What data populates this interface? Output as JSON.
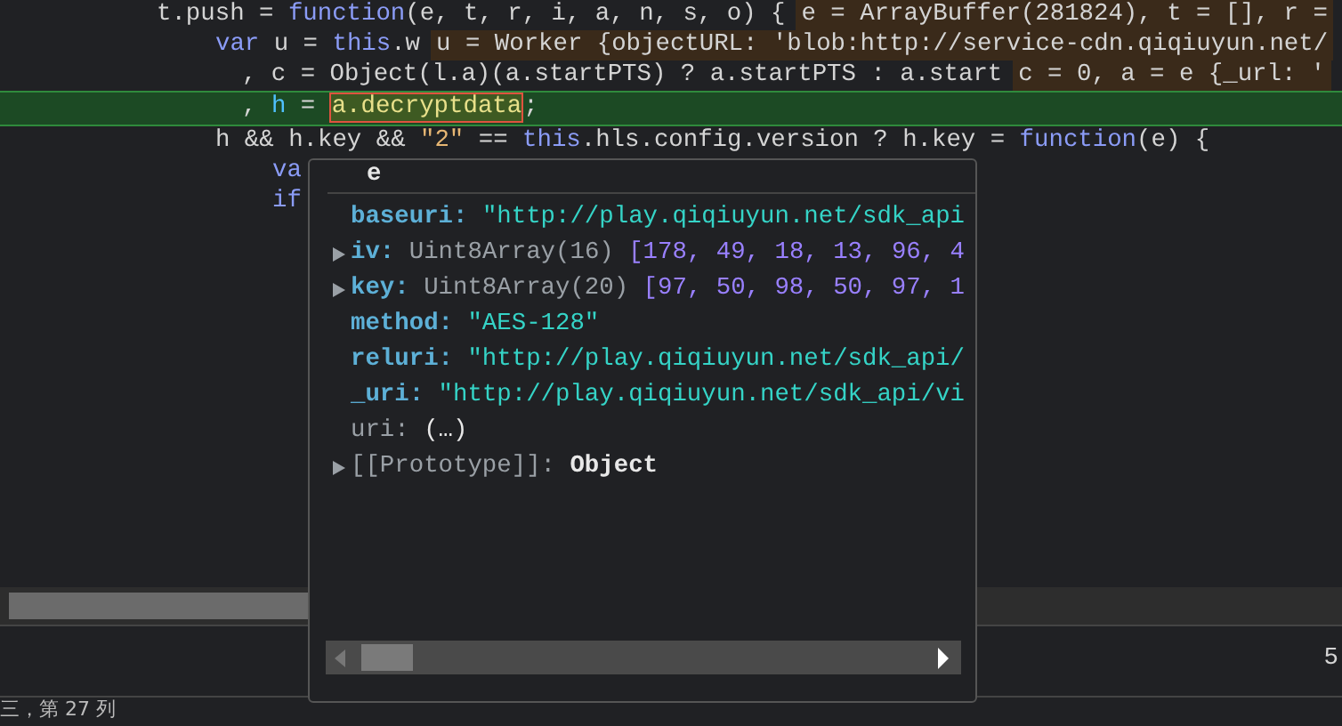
{
  "code_lines": [
    {
      "segments": [
        {
          "text": "t.push = ",
          "kind": "plain"
        },
        {
          "text": "function",
          "kind": "keyword"
        },
        {
          "text": "(e, t, r, i, a, n, s, o) {",
          "kind": "plain"
        }
      ],
      "inline_value": "e = ArrayBuffer(281824), t = [], r =",
      "highlighted": false
    },
    {
      "segments": [
        {
          "text": "var",
          "kind": "keyword"
        },
        {
          "text": " u = ",
          "kind": "plain"
        },
        {
          "text": "this",
          "kind": "keyword"
        },
        {
          "text": ".w",
          "kind": "plain"
        }
      ],
      "inline_value": "u = Worker {objectURL: 'blob:http://service-cdn.qiqiuyun.net/",
      "highlighted": false
    },
    {
      "segments": [
        {
          "text": ", c = Object(l.a)(a.startPTS) ? a.startPTS : a.start",
          "kind": "plain"
        }
      ],
      "inline_value": "c = 0, a = e {_url: '",
      "highlighted": false
    },
    {
      "segments": [
        {
          "text": ", ",
          "kind": "plain"
        },
        {
          "text": "h",
          "kind": "variable"
        },
        {
          "text": " = ",
          "kind": "plain"
        },
        {
          "text": "a.decryptdata",
          "kind": "hovered"
        },
        {
          "text": ";",
          "kind": "plain"
        }
      ],
      "highlighted": true
    },
    {
      "segments": [
        {
          "text": "h && h.key && ",
          "kind": "plain"
        },
        {
          "text": "\"2\"",
          "kind": "string"
        },
        {
          "text": " == ",
          "kind": "plain"
        },
        {
          "text": "this",
          "kind": "keyword"
        },
        {
          "text": ".hls.config.version ? h.key = ",
          "kind": "plain"
        },
        {
          "text": "function",
          "kind": "keyword"
        },
        {
          "text": "(e) {",
          "kind": "plain"
        }
      ],
      "highlighted": false
    },
    {
      "segments": [
        {
          "text": "va",
          "kind": "keyword"
        }
      ],
      "highlighted": false
    },
    {
      "segments": [
        {
          "text": "if",
          "kind": "keyword"
        }
      ],
      "highlighted": false
    }
  ],
  "popup": {
    "title": "e",
    "properties": [
      {
        "name": "baseuri:",
        "value": "\"http://play.qiqiuyun.net/sdk_api",
        "kind": "string",
        "expandable": false,
        "dimmed": false
      },
      {
        "name": "iv:",
        "type": "Uint8Array(16)",
        "value": "[178, 49, 18, 13, 96, 4",
        "kind": "array",
        "expandable": true,
        "dimmed": false
      },
      {
        "name": "key:",
        "type": "Uint8Array(20)",
        "value": "[97, 50, 98, 50, 97, 1",
        "kind": "array",
        "expandable": true,
        "dimmed": false
      },
      {
        "name": "method:",
        "value": "\"AES-128\"",
        "kind": "string",
        "expandable": false,
        "dimmed": false
      },
      {
        "name": "reluri:",
        "value": "\"http://play.qiqiuyun.net/sdk_api/",
        "kind": "string",
        "expandable": false,
        "dimmed": false
      },
      {
        "name": "_uri:",
        "value": "\"http://play.qiqiuyun.net/sdk_api/vi",
        "kind": "string",
        "expandable": false,
        "dimmed": false
      },
      {
        "name": "uri:",
        "value": "(…)",
        "kind": "getter",
        "expandable": false,
        "dimmed": true
      },
      {
        "name": "[[Prototype]]:",
        "value": "Object",
        "kind": "object",
        "expandable": true,
        "dimmed": true
      }
    ]
  },
  "line_number": "5",
  "status_bar": "三，第 27 列"
}
